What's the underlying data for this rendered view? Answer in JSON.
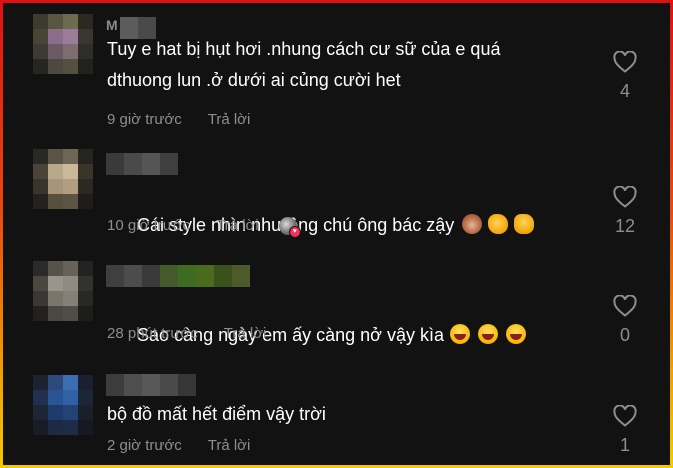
{
  "comments": [
    {
      "name_initials": "M",
      "text": "Tuy e hat bị hụt hơi .nhung cách cư sữ của e quá\ndthuong lun .ở dưới ai củng cười het",
      "time": "9 giờ trước",
      "reply": "Trả lời",
      "likes": "4"
    },
    {
      "text": "Cái style nhìn như ông chú ông bác zậy",
      "emojis": [
        "see-no-evil-monkey-emoji",
        "clapping-hands-emoji",
        "thumbs-up-emoji"
      ],
      "time": "10 giờ trước",
      "reply": "Trả lời",
      "likes": "12"
    },
    {
      "text": "Sao càng ngày em ấy càng nở vậy kìa",
      "emojis": [
        "laughing-emoji",
        "laughing-emoji",
        "laughing-emoji"
      ],
      "time": "28 phút trước",
      "reply": "Trả lời",
      "likes": "0"
    },
    {
      "text": "bộ đồ mất hết điểm vậy trời",
      "time": "2 giờ trước",
      "reply": "Trả lời",
      "likes": "1"
    }
  ],
  "icons": {
    "like": "heart-outline-icon",
    "creator_liked_badge": "heart-badge-icon"
  },
  "colors": {
    "background": "#121212",
    "text_primary": "#ffffff",
    "text_secondary": "#8e8e8e",
    "border_gradient_top": "#e01010",
    "border_gradient_bottom": "#f5c800",
    "like_badge": "#fe2c55"
  }
}
